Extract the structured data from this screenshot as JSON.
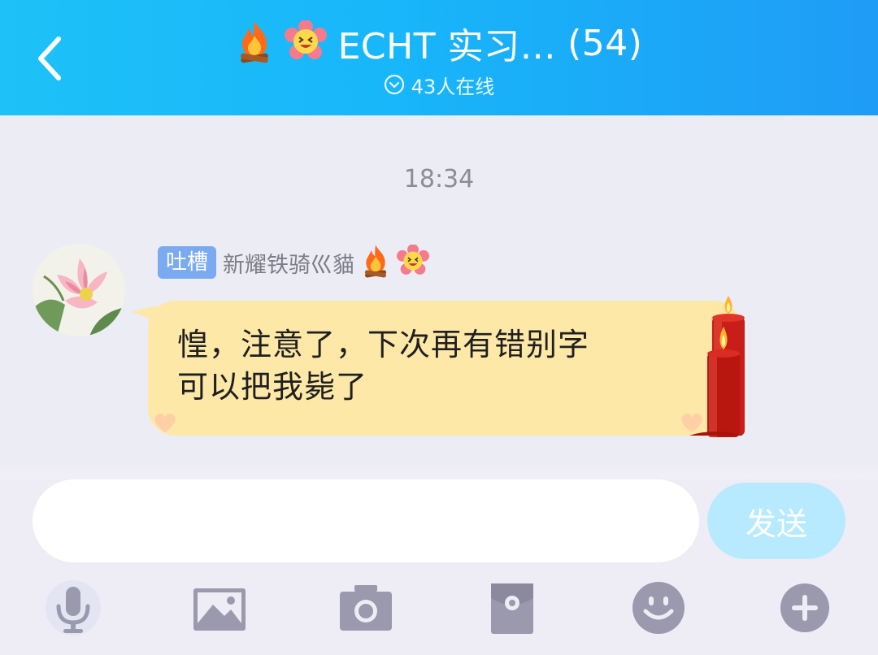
{
  "header": {
    "title": "ECHT 实习…",
    "member_count": "(54)",
    "online_status": "43人在线"
  },
  "chat": {
    "timestamp": "18:34",
    "messages": [
      {
        "sender_tag": "吐槽",
        "sender_name": "新耀铁骑巛貓",
        "text_line1": "惶，注意了，下次再有错别字",
        "text_line2": "可以把我毙了"
      }
    ]
  },
  "composer": {
    "input_value": "",
    "input_placeholder": "",
    "send_label": "发送"
  },
  "toolbar": {
    "items": [
      {
        "icon": "microphone-icon"
      },
      {
        "icon": "image-icon"
      },
      {
        "icon": "camera-icon"
      },
      {
        "icon": "red-packet-icon"
      },
      {
        "icon": "emoji-icon"
      },
      {
        "icon": "plus-icon"
      }
    ]
  },
  "colors": {
    "header_gradient_start": "#1ec1f8",
    "header_gradient_end": "#1f9cf6",
    "bubble": "#fde8a8",
    "tag": "#7aaaf0",
    "send_button": "#b7eaff",
    "toolbar_icon": "#9a99ad"
  }
}
